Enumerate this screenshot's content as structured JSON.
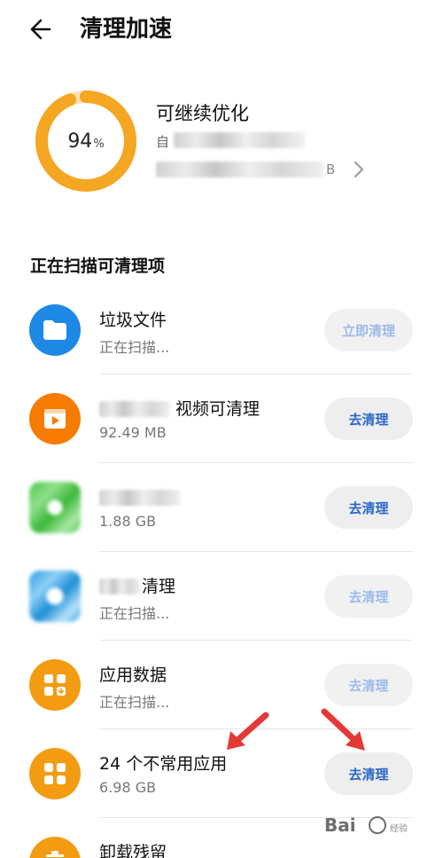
{
  "header": {
    "title": "清理加速",
    "back_icon": "arrow-left-icon"
  },
  "summary": {
    "percent_value": "94",
    "percent_unit": "%",
    "percent": 0.94,
    "ring_color": "#f5a623",
    "title": "可继续优化",
    "line1_visible": "自",
    "line2_visible_tail": "B"
  },
  "section_title": "正在扫描可清理项",
  "rows": [
    {
      "icon": "folder-icon",
      "icon_color": "#1e88e5",
      "title": "垃圾文件",
      "subtitle": "正在扫描...",
      "button": "立即清理",
      "button_enabled": false
    },
    {
      "icon": "video-icon",
      "icon_color": "#f57c00",
      "title": "视频可清理",
      "subtitle": "92.49 MB",
      "button": "去清理",
      "button_enabled": true
    },
    {
      "icon": "app-icon",
      "icon_color": "#5ccf5a",
      "title": "",
      "subtitle": "1.88 GB",
      "button": "去清理",
      "button_enabled": true
    },
    {
      "icon": "app-icon",
      "icon_color": "#3aa6e8",
      "title": "清理",
      "subtitle": "正在扫描...",
      "button": "去清理",
      "button_enabled": false
    },
    {
      "icon": "app-data-icon",
      "icon_color": "#f39c12",
      "title": "应用数据",
      "subtitle": "正在扫描...",
      "button": "去清理",
      "button_enabled": false
    },
    {
      "icon": "apps-grid-icon",
      "icon_color": "#f39c12",
      "title": "24 个不常用应用",
      "subtitle": "6.98 GB",
      "button": "去清理",
      "button_enabled": true
    },
    {
      "icon": "trash-icon",
      "icon_color": "#f39c12",
      "title": "卸载残留",
      "subtitle": "",
      "button": "",
      "button_enabled": false
    }
  ],
  "annotation_color": "#e53935",
  "watermark": {
    "text": "Bai",
    "sub": "经验"
  }
}
